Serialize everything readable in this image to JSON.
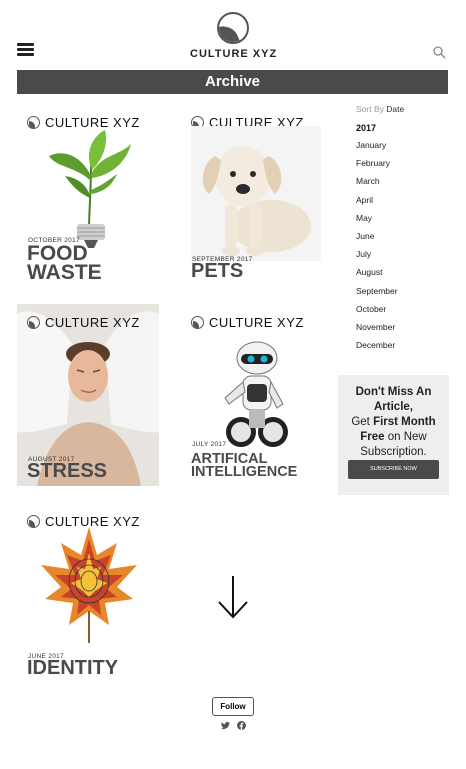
{
  "header": {
    "logo_text": "CULTURE XYZ",
    "menu_icon": "hamburger-menu-icon",
    "search_icon": "search-icon"
  },
  "banner": {
    "title": "Archive"
  },
  "covers": [
    {
      "brand": "CULTURE  XYZ",
      "date": "OCTOBER 2017",
      "title_line1": "FOOD",
      "title_line2": "WASTE",
      "image": "lightbulb-plant-image"
    },
    {
      "brand": "CULTURE  XYZ",
      "date": "SEPTEMBER 2017",
      "title_line1": "PETS",
      "title_line2": "",
      "image": "puppy-image"
    },
    {
      "brand": "CULTURE  XYZ",
      "date": "AUGUST 2017",
      "title_line1": "STRESS",
      "title_line2": "",
      "image": "woman-pillows-image"
    },
    {
      "brand": "CULTURE  XYZ",
      "date": "JULY 2017",
      "title_line1": "ARTIFICAL",
      "title_line2": "INTELLIGENCE",
      "image": "robot-image"
    },
    {
      "brand": "CULTURE  XYZ",
      "date": "JUNE 2017",
      "title_line1": "IDENTITY",
      "title_line2": "",
      "image": "fingerprint-leaf-image"
    }
  ],
  "sidebar": {
    "sort_label": "Sort By",
    "sort_value": "Date",
    "year": "2017",
    "months": [
      "January",
      "February",
      "March",
      "April",
      "May",
      "June",
      "July",
      "August",
      "September",
      "October",
      "November",
      "December"
    ]
  },
  "ad": {
    "line1": "Don't Miss An Article,",
    "line2a": "Get ",
    "line2b": "First Month",
    "line3a": "Free",
    "line3b": " on New",
    "line4": "Subscription.",
    "button": "SUBSCRIBE NOW"
  },
  "footer": {
    "follow_label": "Follow",
    "social": [
      "twitter-icon",
      "facebook-icon"
    ]
  },
  "colors": {
    "banner": "#4a4a4a",
    "ad_bg": "#eeeeee",
    "title_gray": "#4a4a4a"
  }
}
